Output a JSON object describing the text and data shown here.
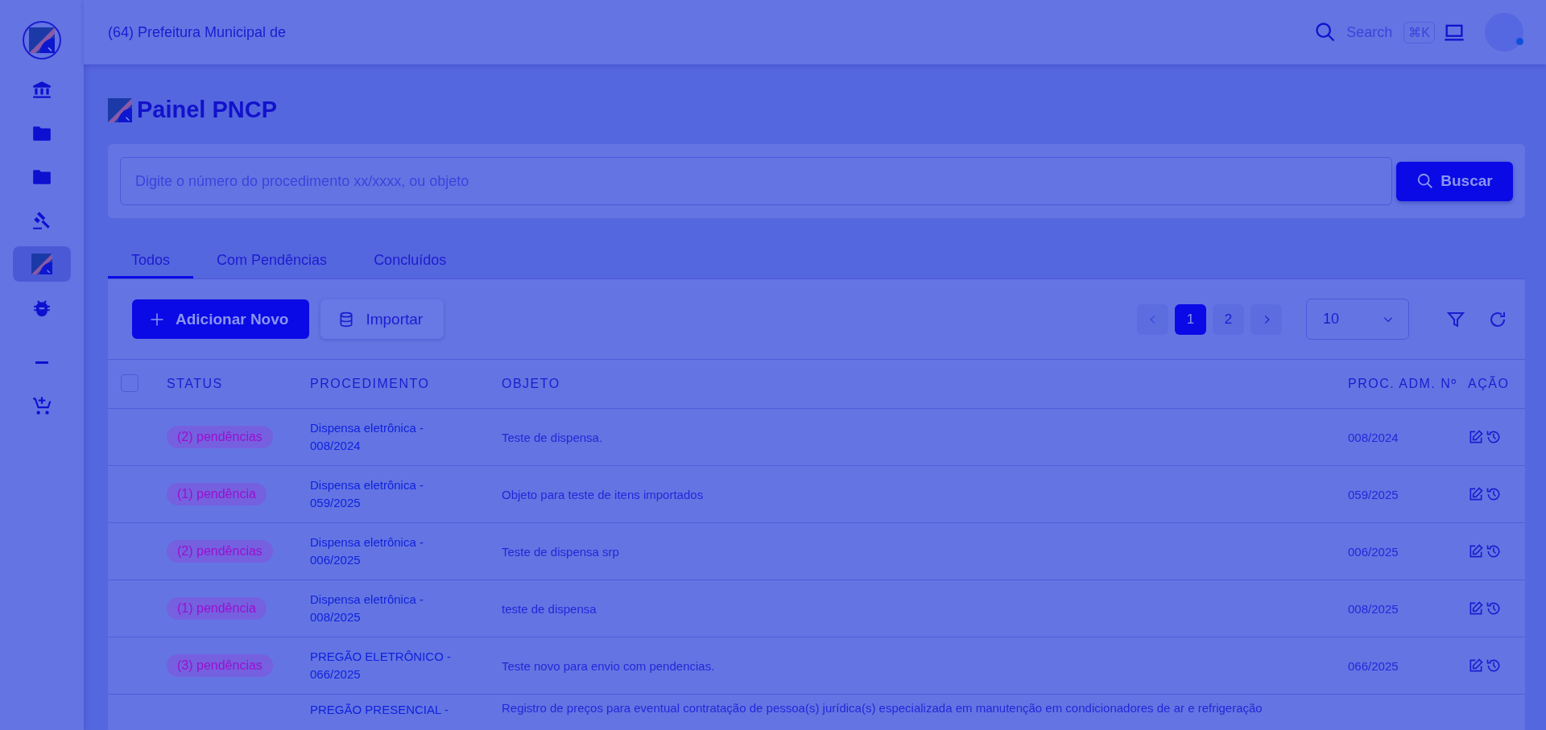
{
  "topbar": {
    "title": "(64) Prefeitura Municipal de",
    "search_label": "Search",
    "shortcut": "⌘K"
  },
  "sidebar": {
    "items": [
      {
        "selected": false
      },
      {
        "selected": false
      },
      {
        "selected": false
      },
      {
        "selected": false
      },
      {
        "selected": true
      },
      {
        "selected": false
      },
      {
        "selected": false
      },
      {
        "selected": false
      }
    ]
  },
  "page": {
    "title": "Painel PNCP"
  },
  "search": {
    "placeholder": "Digite o número do procedimento xx/xxxx, ou objeto",
    "button": "Buscar"
  },
  "tabs": [
    {
      "label": "Todos",
      "selected": true
    },
    {
      "label": "Com Pendências",
      "selected": false
    },
    {
      "label": "Concluídos",
      "selected": false
    }
  ],
  "toolbar": {
    "add_button": "Adicionar Novo",
    "import_button": "Importar"
  },
  "pagination": {
    "pages": [
      {
        "label": "1",
        "selected": true
      },
      {
        "label": "2",
        "selected": false
      }
    ]
  },
  "page_size": {
    "value": "10"
  },
  "table": {
    "select_all": {
      "checked": false
    },
    "columns": [
      "STATUS",
      "PROCEDIMENTO",
      "OBJETO",
      "PROC. ADM. Nº",
      "AÇÃO"
    ],
    "rows": [
      {
        "status": "(2) pendências",
        "procedimento": "Dispensa eletrônica - 008/2024",
        "objeto": "Teste de dispensa.",
        "proc_adm": "008/2024"
      },
      {
        "status": "(1) pendência",
        "procedimento": "Dispensa eletrônica - 059/2025",
        "objeto": "Objeto para teste de itens importados",
        "proc_adm": "059/2025"
      },
      {
        "status": "(2) pendências",
        "procedimento": "Dispensa eletrônica - 006/2025",
        "objeto": "Teste de dispensa srp",
        "proc_adm": "006/2025"
      },
      {
        "status": "(1) pendência",
        "procedimento": "Dispensa eletrônica - 008/2025",
        "objeto": "teste de dispensa",
        "proc_adm": "008/2025"
      },
      {
        "status": "(3) pendências",
        "procedimento": "PREGÃO ELETRÔNICO - 066/2025",
        "objeto": "Teste novo para envio com pendencias.",
        "proc_adm": "066/2025"
      },
      {
        "procedimento": "PREGÃO PRESENCIAL -",
        "objeto": "Registro de preços para eventual contratação de pessoa(s) jurídica(s) especializada em manutenção em condicionadores de ar e refrigeração"
      }
    ]
  }
}
